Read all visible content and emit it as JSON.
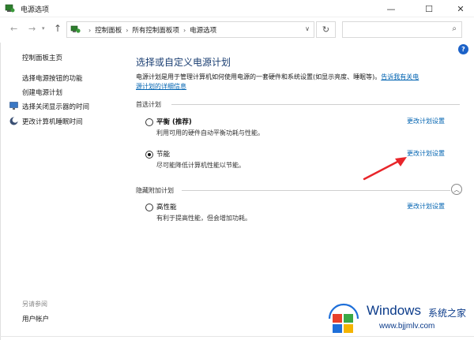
{
  "window": {
    "title": "电源选项",
    "minimize_glyph": "—",
    "maximize_glyph": "☐",
    "close_glyph": "✕"
  },
  "nav": {
    "back_glyph": "←",
    "forward_glyph": "→",
    "recent_glyph": "▾",
    "up_glyph": "↑",
    "refresh_glyph": "↻"
  },
  "breadcrumb": {
    "items": [
      "控制面板",
      "所有控制面板项",
      "电源选项"
    ],
    "separator": "›",
    "dropdown_glyph": "∨"
  },
  "search": {
    "placeholder": "",
    "icon": "search-icon",
    "glyph": "⌕"
  },
  "help": {
    "label": "?"
  },
  "sidebar": {
    "home_label": "控制面板主页",
    "items": [
      {
        "label": "选择电源按钮的功能",
        "icon": ""
      },
      {
        "label": "创建电源计划",
        "icon": ""
      },
      {
        "label": "选择关闭显示器的时间",
        "icon": "monitor-icon"
      },
      {
        "label": "更改计算机睡眠时间",
        "icon": "moon-icon"
      }
    ],
    "see_also_label": "另请参阅",
    "user_accounts_label": "用户帐户"
  },
  "main": {
    "title": "选择或自定义电源计划",
    "description": "电源计划是用于管理计算机如何使用电源的一套硬件和系统设置(如显示亮度、睡眠等)。",
    "description_link_1": "告诉我有关电",
    "description_link_2": "源计划的详细信息",
    "preferred_group_label": "首选计划",
    "hidden_group_label": "隐藏附加计划",
    "collapse_glyph": "︿",
    "plans": [
      {
        "name": "平衡 (推荐)",
        "desc": "利用可用的硬件自动平衡功耗与性能。",
        "link": "更改计划设置",
        "selected": false
      },
      {
        "name": "节能",
        "desc": "尽可能降低计算机性能以节能。",
        "link": "更改计划设置",
        "selected": true
      },
      {
        "name": "高性能",
        "desc": "有利于提高性能，但会增加功耗。",
        "link": "更改计划设置",
        "selected": false
      }
    ]
  },
  "watermark": {
    "title": "Windows",
    "subtitle": "系统之家",
    "url": "www.bjjmlv.com"
  },
  "colors": {
    "link": "#0063b1",
    "title": "#1a3e72",
    "annotation_arrow": "#e8252a",
    "watermark": "#0b3b8a"
  }
}
